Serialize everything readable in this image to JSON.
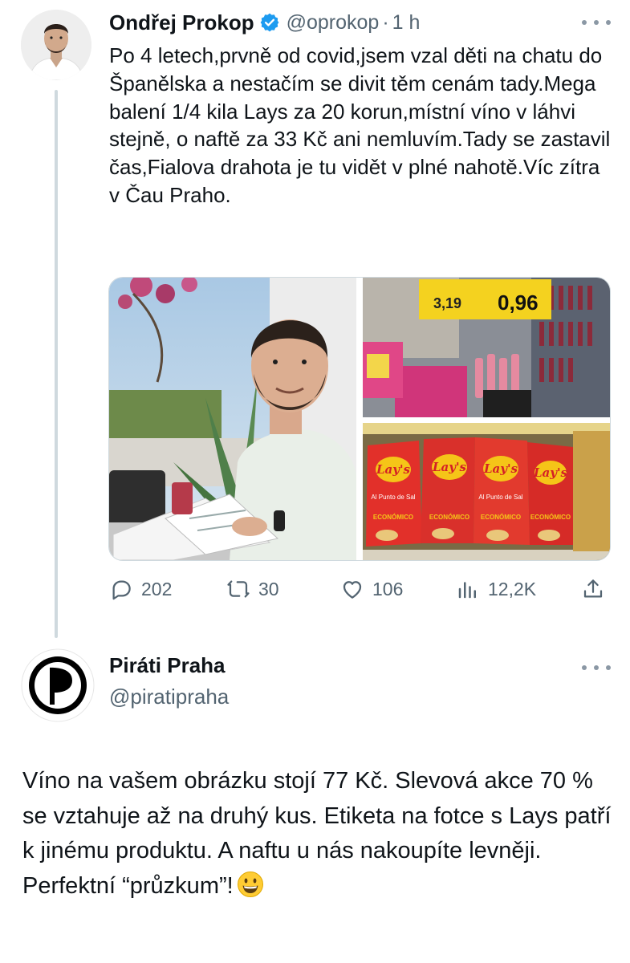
{
  "tweet1": {
    "author_name": "Ondřej Prokop",
    "handle": "@oprokop",
    "separator": "·",
    "time": "1 h",
    "text": "Po 4 letech,prvně od covid,jsem vzal děti na chatu do Španělska a nestačím se divit těm cenám tady.Mega balení 1/4 kila Lays za 20 korun,místní víno v láhvi stejně, o naftě za 33 Kč ani nemluvím.Tady se zastavil čas,Fialova drahota je tu vidět v plné nahotě.Víc zítra v Čau Praho.",
    "media": {
      "price_tag_left": "3,19",
      "price_tag_right": "0,96",
      "lays_label": "Lay's",
      "lays_flavor": "Al Punto de Sal",
      "lays_tag": "ECONÓMICO"
    },
    "stats": {
      "replies": "202",
      "retweets": "30",
      "likes": "106",
      "views": "12,2K"
    },
    "icons": {
      "reply": "reply-icon",
      "retweet": "retweet-icon",
      "like": "heart-icon",
      "views": "analytics-icon",
      "share": "share-icon",
      "verified": "verified-badge-icon",
      "more": "more-icon"
    },
    "colors": {
      "verified": "#1d9bf0",
      "muted": "#536471"
    }
  },
  "tweet2": {
    "author_name": "Piráti Praha",
    "handle": "@piratipraha",
    "text": "Víno na vašem obrázku stojí 77 Kč. Slevová akce 70 % se vztahuje až na druhý kus. Etiketa na fotce s Lays patří k jinému produktu. A naftu u nás nakoupíte levněji. Perfektní “průzkum”!",
    "emoji": "grinning-face-emoji"
  }
}
